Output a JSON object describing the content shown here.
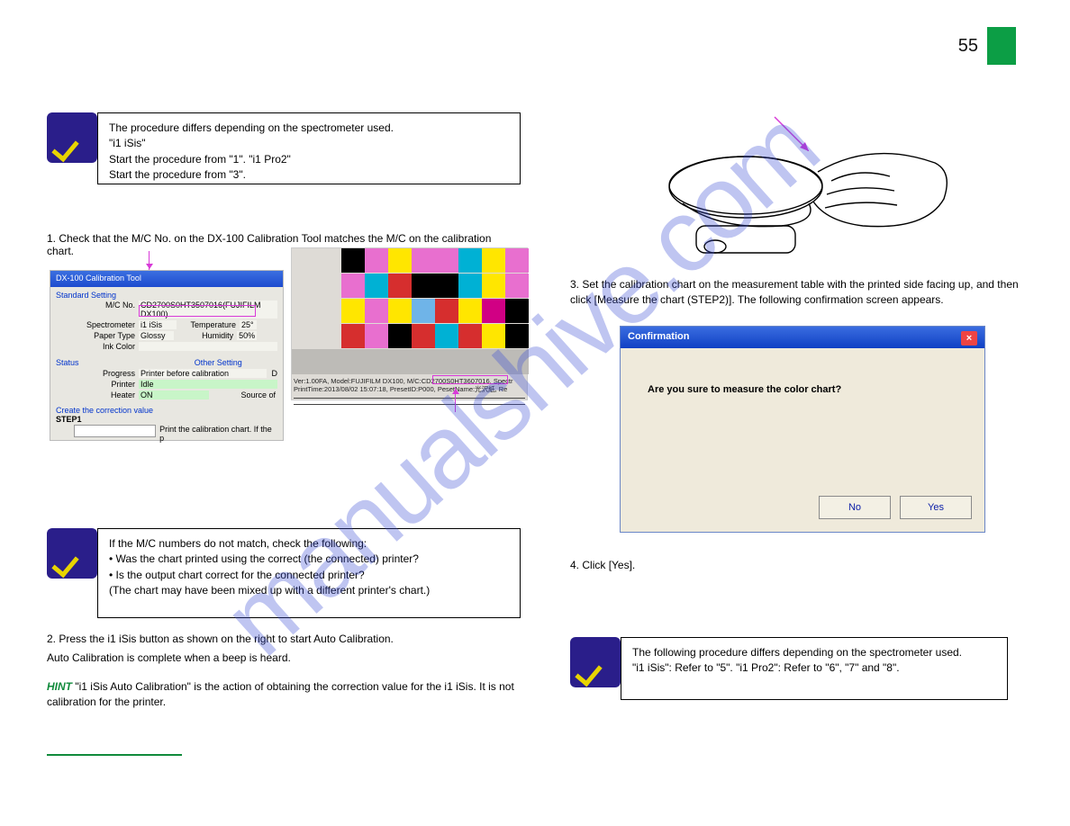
{
  "page_number": "55",
  "watermark": "manualshive.com",
  "check1": {
    "line1": " The procedure differs depending on the spectrometer used.",
    "line2": "\"i1 iSis\"",
    "line3": "Start the procedure from \"1\". \"i1 Pro2\"",
    "line4": "Start the procedure from \"3\"."
  },
  "match_check_text": "1. Check that the M/C No. on the DX-100 Calibration Tool matches the M/C on the calibration chart.",
  "shot1": {
    "title": "DX-100 Calibration Tool",
    "section_standard": "Standard Setting",
    "mc_label": "M/C No.",
    "mc_value": "CD2700S0HT3507016(FUJIFILM DX100)",
    "spectro_label": "Spectrometer",
    "spectro_value": "i1 iSis",
    "temp_label": "Temperature",
    "temp_value": "25°",
    "paper_label": "Paper Type",
    "paper_value": "Glossy",
    "humidity_label": "Humidity",
    "humidity_value": "50%",
    "ink_label": "Ink Color",
    "section_status": "Status",
    "section_other": "Other Setting",
    "progress_label": "Progress",
    "progress_value": "Printer before calibration",
    "printer_label": "Printer",
    "printer_value": "Idle",
    "heater_label": "Heater",
    "heater_value": "ON",
    "dest_label": "D",
    "source_label": "Source of",
    "section_create": "Create the correction value",
    "step1": "STEP1",
    "step1_text": "Print the calibration chart. If the p"
  },
  "shot2": {
    "info1_a": "Ver:1.00FA, Model:FUJIFILM DX100,",
    "info1_b": "M/C:CD2700S0HT3607016,",
    "info1_c": "Spectr",
    "info2_a": "PrintTime:2013/08/02 15:07:18, PresetID:P000, P",
    "info2_b": "esetName:光沢紙, Re"
  },
  "check2": {
    "line1": " If the M/C numbers do not match, check the following:",
    "line2": "• Was the chart printed using the correct (the connected) printer?",
    "line3": "• Is the output chart correct for the connected printer?",
    "line4": "(The chart may have been mixed up with a different printer's chart.)"
  },
  "step2": {
    "text1": "2. Press the i1 iSis button as shown on the right to start Auto Calibration.",
    "text2": "Auto Calibration is complete when a beep is heard.",
    "hint_prefix": "HINT ",
    "hint_body": "\"i1 iSis Auto Calibration\" is the action of obtaining the correction value for the i1 iSis. It is not calibration for the printer."
  },
  "step3": {
    "num": "3.",
    "text": "Set the calibration chart on the measurement table with the printed side facing up, and then click [Measure the chart (STEP2)]. The following confirmation screen appears."
  },
  "step4": {
    "num": "4.",
    "text": "Click [Yes]."
  },
  "dialog": {
    "title": "Confirmation",
    "message": "Are you sure to measure the color chart?",
    "no": "No",
    "yes": "Yes"
  },
  "check3": {
    "line1": " The following procedure differs depending on the spectrometer used.",
    "line2": "\"i1 iSis\": Refer to \"5\".   \"i1 Pro2\": Refer to \"6\", \"7\" and \"8\"."
  },
  "colors": {
    "patches": [
      "#000000",
      "#e86fcf",
      "#ffe600",
      "#e86fcf",
      "#e86fcf",
      "#00b1d4",
      "#ffe600",
      "#e86fcf",
      "#e86fcf",
      "#00b1d4",
      "#d62e2e",
      "#000000",
      "#000000",
      "#00b1d4",
      "#ffe600",
      "#e86fcf",
      "#ffe600",
      "#e86fcf",
      "#ffe600",
      "#6fb4e8",
      "#d62e2e",
      "#ffe600",
      "#d10084",
      "#000000",
      "#d62e2e",
      "#e86fcf",
      "#000000",
      "#d62e2e",
      "#00b1d4",
      "#d62e2e",
      "#ffe600",
      "#000000"
    ]
  }
}
